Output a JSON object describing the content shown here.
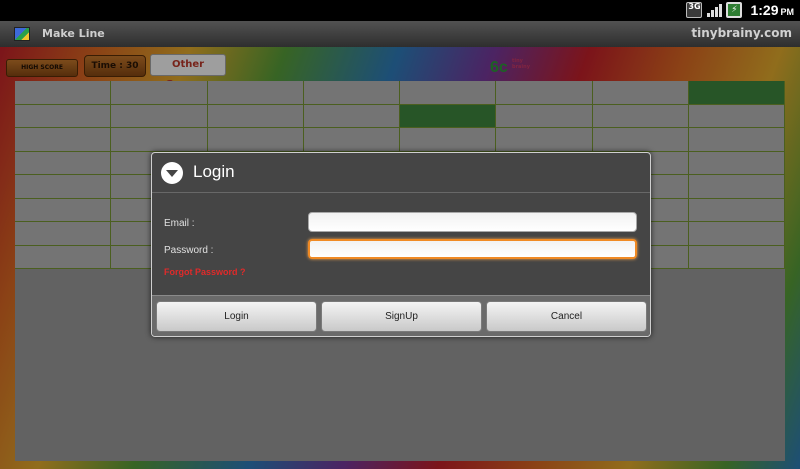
{
  "status_bar": {
    "network_label": "3G",
    "time": "1:29",
    "ampm": "PM",
    "icons": [
      "3g-network-icon",
      "signal-icon",
      "battery-icon"
    ]
  },
  "app_bar": {
    "title": "Make Line",
    "site": "tinybrainy.com"
  },
  "game": {
    "high_score_label": "HIGH SCORE",
    "time_label": "Time : 30",
    "other_games_label": "Other Games..",
    "logo_number": "6c",
    "logo_brand": "tiny brainy",
    "grid": {
      "rows": 8,
      "cols": 8,
      "filled_cells": [
        [
          0,
          7
        ],
        [
          1,
          4
        ]
      ],
      "cell_color": "#bcbcbc",
      "filled_color": "#3f8a3f",
      "line_color": "#7a9a32"
    }
  },
  "dialog": {
    "title": "Login",
    "email_label": "Email :",
    "email_value": "",
    "password_label": "Password :",
    "password_value": "",
    "forgot_label": "Forgot Password ?",
    "buttons": {
      "login": "Login",
      "signup": "SignUp",
      "cancel": "Cancel"
    },
    "focus_color": "#f08a24",
    "error_color": "#e12a2a"
  }
}
